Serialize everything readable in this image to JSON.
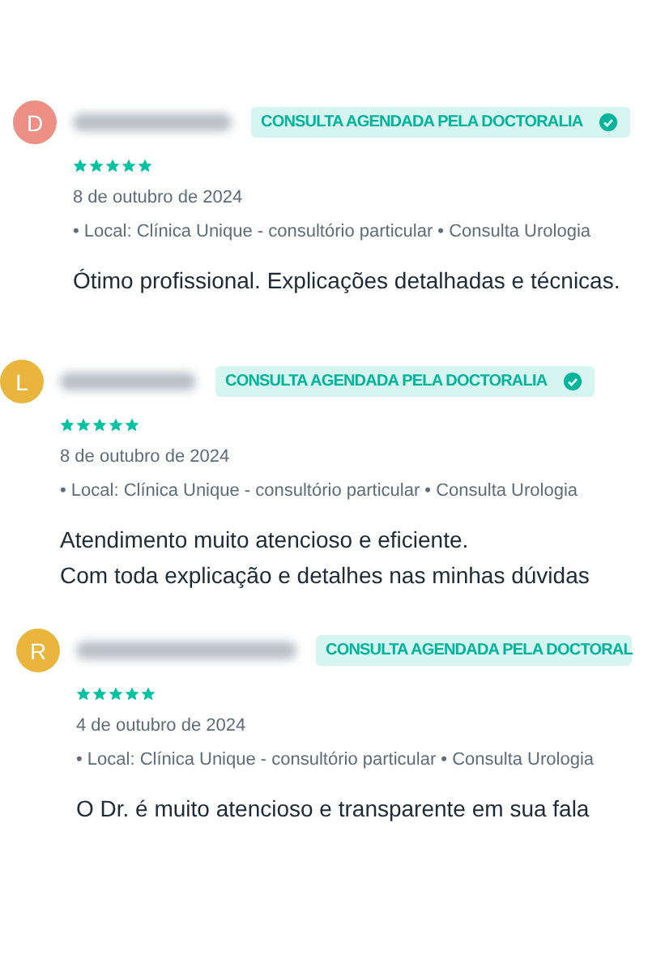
{
  "reviews": [
    {
      "initial": "D",
      "color": "#ee8f86",
      "badge": "CONSULTA AGENDADA PELA DOCTORALIA",
      "verified": true,
      "stars": 5,
      "date": "8 de outubro de 2024",
      "details": "• Local: Clínica Unique - consultório particular • Consulta Urologia",
      "text": [
        "Ótimo profissional. Explicações detalhadas e técnicas."
      ]
    },
    {
      "initial": "L",
      "color": "#e9b53c",
      "badge": "CONSULTA AGENDADA PELA DOCTORALIA",
      "verified": true,
      "stars": 5,
      "date": "8 de outubro de 2024",
      "details": "• Local: Clínica Unique - consultório particular • Consulta Urologia",
      "text": [
        "Atendimento muito atencioso e eficiente.",
        "Com toda explicação e detalhes nas minhas dúvidas"
      ]
    },
    {
      "initial": "R",
      "color": "#e9b53c",
      "badge": "CONSULTA AGENDADA PELA DOCTORAL",
      "stars": 5,
      "date": "4 de outubro de 2024",
      "details": "• Local: Clínica Unique - consultório particular • Consulta Urologia",
      "text": [
        "O Dr. é muito atencioso e transparente em sua fala"
      ]
    }
  ]
}
